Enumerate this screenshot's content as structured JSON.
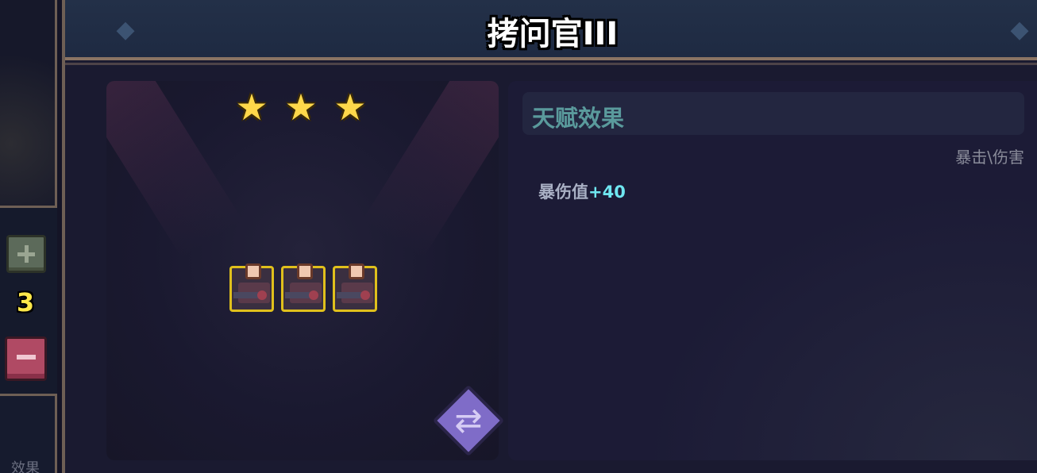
{
  "left": {
    "count": "3",
    "effect_tab": "效果"
  },
  "title": "拷问官III",
  "stars": [
    "★",
    "★",
    "★"
  ],
  "units": [
    "unit-1",
    "unit-2",
    "unit-3"
  ],
  "talent": {
    "header": "天赋效果",
    "category": "暴击\\伤害",
    "effect_label": "暴伤值",
    "effect_value": "+40"
  },
  "icons": {
    "plus": "plus-icon",
    "minus": "minus-icon",
    "swap": "swap-icon",
    "star": "star-icon"
  },
  "colors": {
    "title_bar": "#233048",
    "accent_cyan": "#6fe6f0",
    "star": "#ffd84a",
    "unit_border": "#e0c01c",
    "minus": "#b04a64",
    "plus": "#5c6a5a"
  }
}
